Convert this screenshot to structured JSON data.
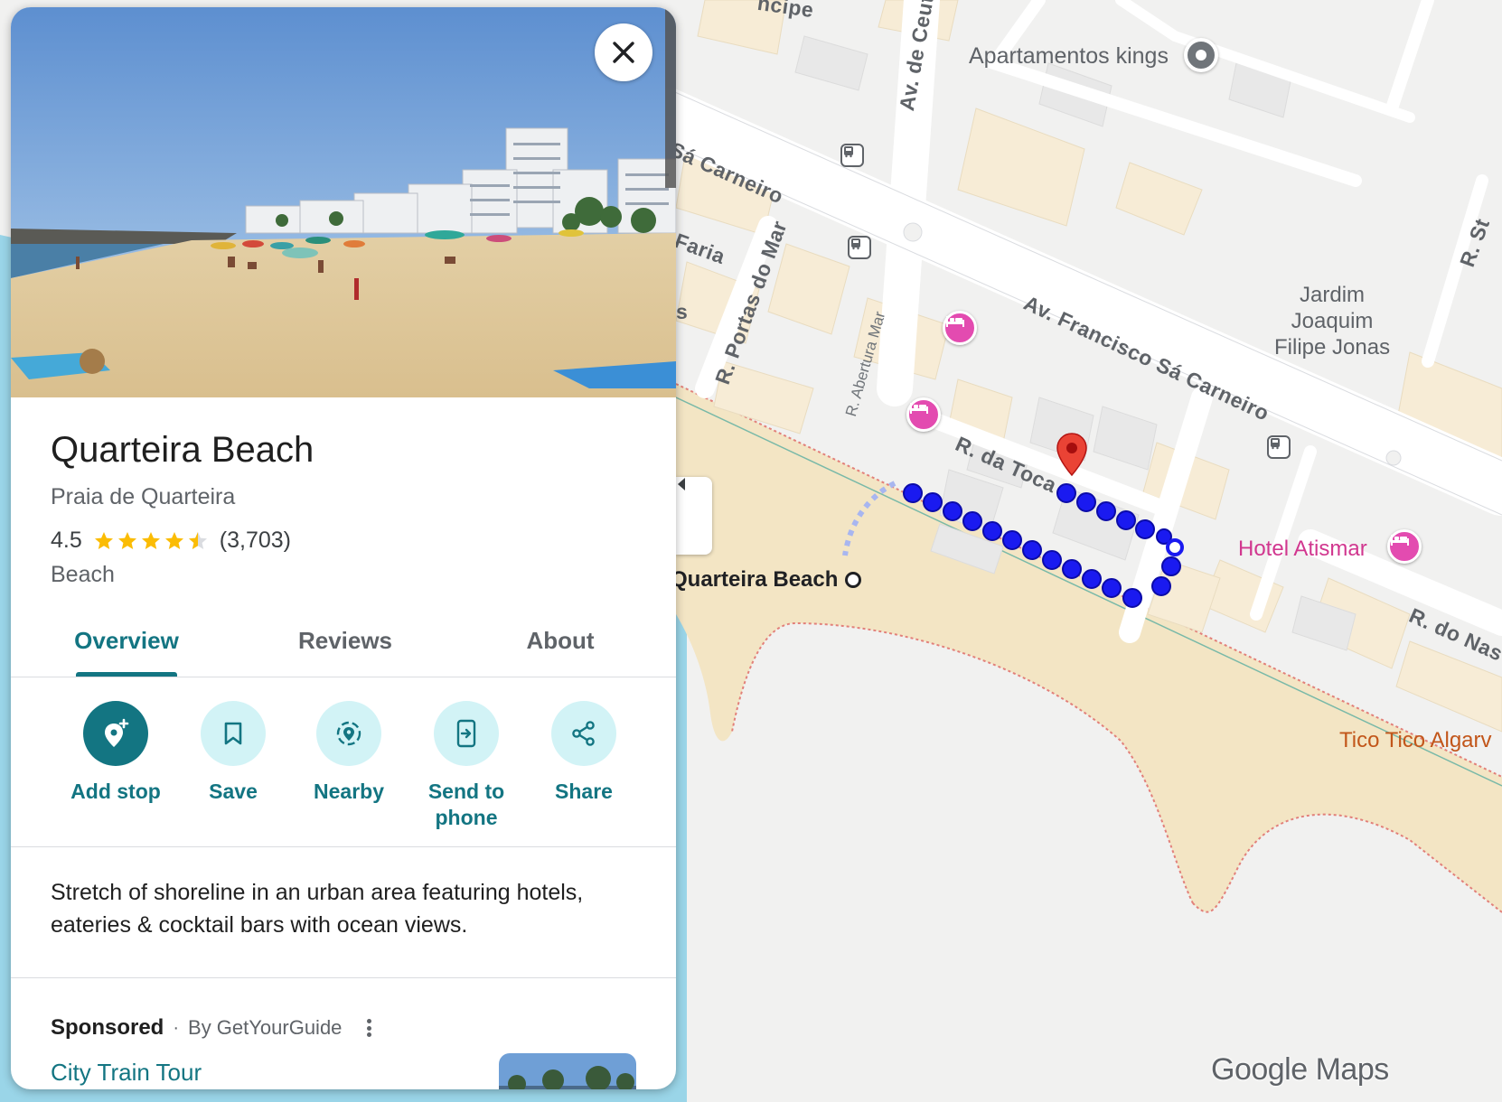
{
  "place": {
    "title": "Quarteira Beach",
    "subtitle": "Praia de Quarteira",
    "rating": "4.5",
    "review_count": "(3,703)",
    "category": "Beach",
    "description": "Stretch of shoreline in an urban area featuring hotels, eateries & cocktail bars with ocean views."
  },
  "tabs": [
    {
      "label": "Overview",
      "active": true
    },
    {
      "label": "Reviews",
      "active": false
    },
    {
      "label": "About",
      "active": false
    }
  ],
  "actions": [
    {
      "label": "Add stop",
      "icon": "add-location-icon"
    },
    {
      "label": "Save",
      "icon": "bookmark-icon"
    },
    {
      "label": "Nearby",
      "icon": "nearby-icon"
    },
    {
      "label": "Send to phone",
      "icon": "send-to-phone-icon"
    },
    {
      "label": "Share",
      "icon": "share-icon"
    }
  ],
  "sponsored": {
    "label": "Sponsored",
    "separator": "·",
    "by": "By GetYourGuide",
    "tour_title": "City Train Tour"
  },
  "map": {
    "labels": {
      "apartamentos": "Apartamentos kings",
      "av_ceuta": "Av. de Ceuta",
      "sa_carneiro_top": "Sá Carneiro",
      "faria": "Faria",
      "portas_do_mar": "R. Portas do Mar",
      "abertura_mar": "R. Abertura Mar",
      "francisco": "Av. Francisco Sá Carneiro",
      "jardim": "Jardim\nJoaquim\nFilipe Jonas",
      "r_da_toca": "R. da Toca",
      "hotel_atismar": "Hotel Atismar",
      "r_do_nas": "R. do Nas",
      "tico_tico": "Tico Tico Algarv",
      "quarteira_beach": "Quarteira Beach",
      "r_st": "R. St",
      "ncipe": "ncipe",
      "s_partial": "s"
    },
    "logo": "Google Maps",
    "colors": {
      "water": "#9ad5e8",
      "sand": "#f3e5c4",
      "land": "#f1f1f0",
      "road": "#ffffff",
      "route": "#1a1af0",
      "hotel": "#e34bb0",
      "pin": "#ea4335",
      "accent": "#137582"
    }
  }
}
